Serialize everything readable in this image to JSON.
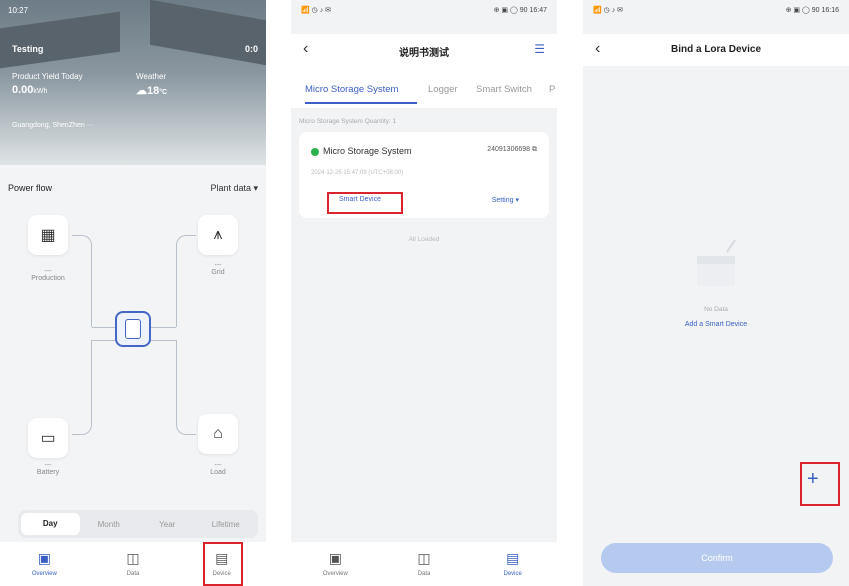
{
  "phone1": {
    "header": {
      "status_time": "10:27",
      "plant_name": "Testing",
      "yield_label": "Product Yield Today",
      "yield_value": "0.00",
      "yield_unit": "kWh",
      "weather_label": "Weather",
      "weather_value": "18",
      "weather_unit": "°C",
      "location": "Guangdong, ShenZhen ···",
      "time_badge": "0:0"
    },
    "power_flow": {
      "title": "Power flow",
      "plant_data_label": "Plant data",
      "nodes": {
        "production": {
          "value": "---",
          "label": "Production"
        },
        "grid": {
          "value": "---",
          "label": "Grid"
        },
        "battery": {
          "value": "---",
          "label": "Battery"
        },
        "load": {
          "value": "---",
          "label": "Load"
        }
      }
    },
    "period_tabs": [
      "Day",
      "Month",
      "Year",
      "Lifetime"
    ],
    "tabbar": [
      {
        "label": "Overview",
        "icon": "home-icon"
      },
      {
        "label": "Data",
        "icon": "chart-icon"
      },
      {
        "label": "Device",
        "icon": "device-icon"
      }
    ]
  },
  "phone2": {
    "status_left": "📶 ◷ ♪ ✉",
    "status_right": "⊕ ▣ ◯ 90 16:47",
    "title": "说明书测试",
    "tabs": [
      "Micro Storage System",
      "Logger",
      "Smart Switch",
      "P"
    ],
    "quantity_text": "Micro Storage System Quantity: 1",
    "device": {
      "name": "Micro Storage System",
      "sn": "24091306698",
      "date": "2024-12-26 15:47:09 (UTC+08:00)",
      "smart_device_label": "Smart Device",
      "setting_label": "Setting"
    },
    "loaded_text": "All Loaded",
    "tabbar": [
      {
        "label": "Overview",
        "icon": "home-icon"
      },
      {
        "label": "Data",
        "icon": "chart-icon"
      },
      {
        "label": "Device",
        "icon": "device-icon"
      }
    ]
  },
  "phone3": {
    "status_left": "📶 ◷ ♪ ✉",
    "status_right": "⊕ ▣ ◯ 90 16:16",
    "title": "Bind a Lora Device",
    "no_data_text": "No Data",
    "add_smart_device": "Add a Smart Device",
    "add_button": "+",
    "confirm_label": "Confirm"
  },
  "colors": {
    "accent": "#3b5fc4",
    "highlight": "#d9232d",
    "online": "#2cb24b"
  }
}
